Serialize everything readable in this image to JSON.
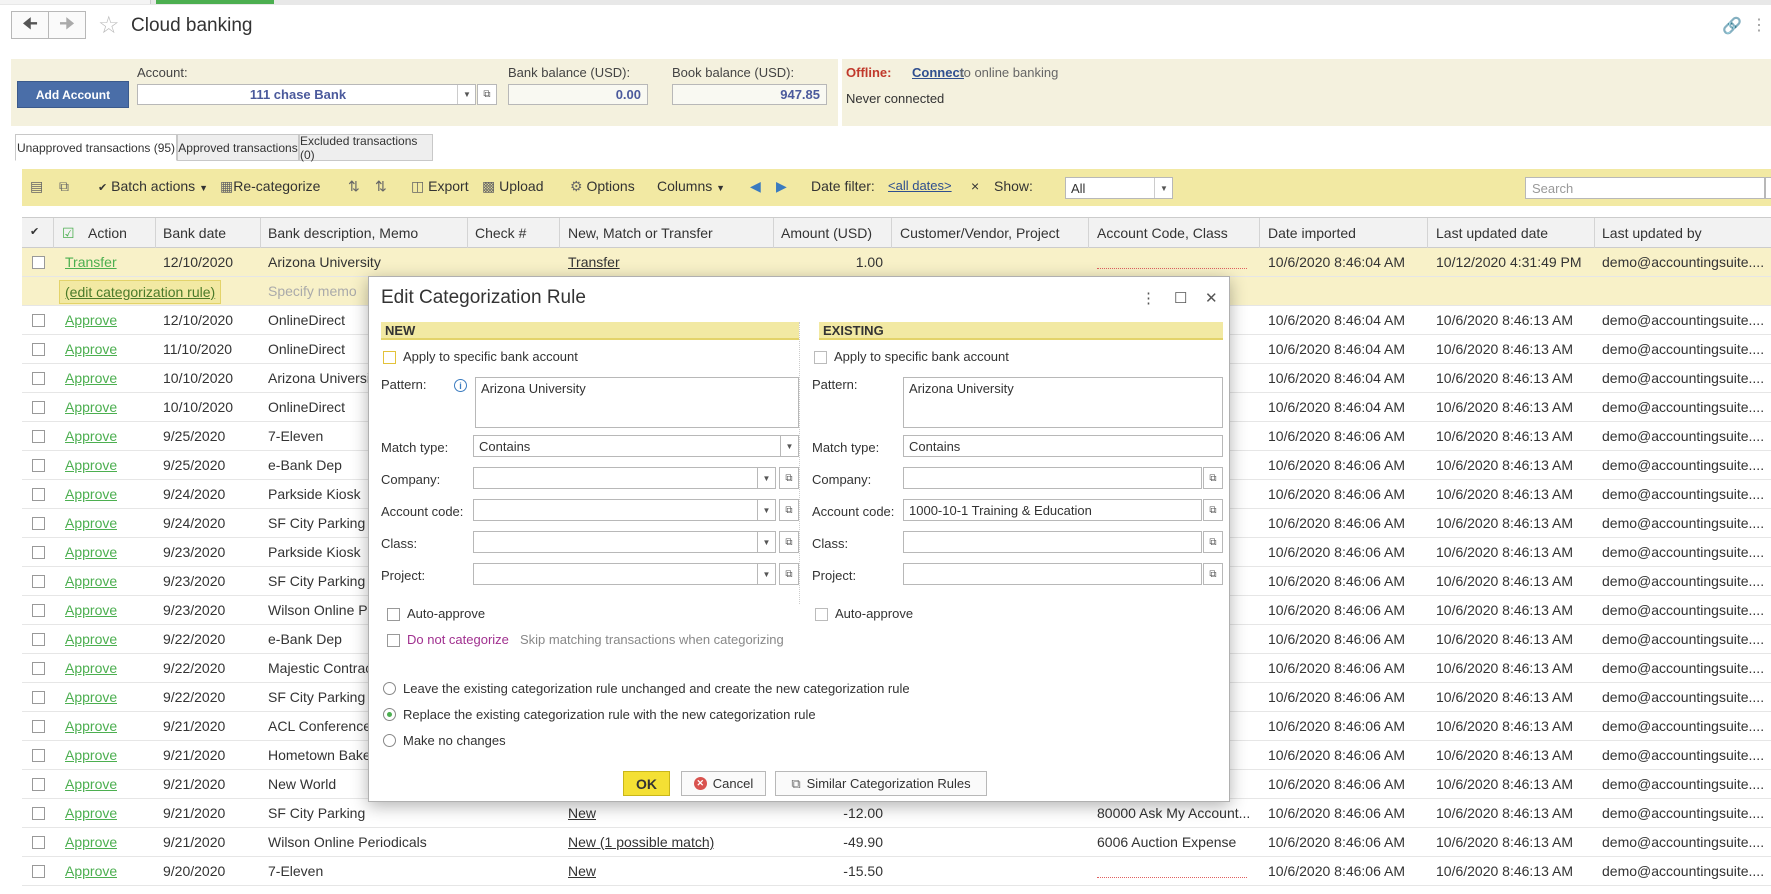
{
  "window": {
    "title": "Cloud banking"
  },
  "account_panel": {
    "add_account_label": "Add Account",
    "account_label": "Account:",
    "account_value": "111 chase Bank",
    "bank_balance_label": "Bank balance (USD):",
    "bank_balance_value": "0.00",
    "book_balance_label": "Book balance (USD):",
    "book_balance_value": "947.85"
  },
  "online_panel": {
    "status": "Offline:",
    "connect_link": "Connect",
    "connect_suffix": "to online banking",
    "connection_info": "Never connected"
  },
  "tabs": [
    {
      "label": "Unapproved transactions (95)",
      "active": true
    },
    {
      "label": "Approved transactions",
      "active": false
    },
    {
      "label": "Excluded transactions (0)",
      "active": false
    }
  ],
  "toolbar": {
    "batch_actions": "Batch actions",
    "recategorize": "Re-categorize",
    "export": "Export",
    "upload": "Upload",
    "options": "Options",
    "columns": "Columns",
    "date_filter_label": "Date filter:",
    "date_filter_value": "<all dates>",
    "clear_filter": "×",
    "show_label": "Show:",
    "show_value": "All",
    "search_placeholder": "Search",
    "search_clear": "×"
  },
  "grid": {
    "columns": [
      "Action",
      "Bank date",
      "Bank description, Memo",
      "Check #",
      "New, Match or Transfer",
      "Amount (USD)",
      "Customer/Vendor, Project",
      "Account Code, Class",
      "Date imported",
      "Last updated date",
      "Last updated by"
    ],
    "selected_row": {
      "action": "Transfer",
      "date": "12/10/2020",
      "description": "Arizona University",
      "check": "",
      "match": "Transfer",
      "amount": "1.00",
      "customer": "",
      "account": "",
      "imported": "10/6/2020 8:46:04 AM",
      "updated": "10/12/2020 4:31:49 PM",
      "by": "demo@accountingsuite...."
    },
    "sub_row": {
      "edit_rule": "(edit categorization rule)",
      "memo_placeholder": "Specify memo"
    },
    "rows": [
      {
        "action": "Approve",
        "date": "12/10/2020",
        "description": "OnlineDirect",
        "match": "",
        "amount": "",
        "account": "",
        "imported": "10/6/2020 8:46:04 AM",
        "updated": "10/6/2020 8:46:13 AM",
        "by": "demo@accountingsuite...."
      },
      {
        "action": "Approve",
        "date": "11/10/2020",
        "description": "OnlineDirect",
        "match": "",
        "amount": "",
        "account": "",
        "imported": "10/6/2020 8:46:04 AM",
        "updated": "10/6/2020 8:46:13 AM",
        "by": "demo@accountingsuite...."
      },
      {
        "action": "Approve",
        "date": "10/10/2020",
        "description": "Arizona University",
        "match": "",
        "amount": "",
        "account": "",
        "imported": "10/6/2020 8:46:04 AM",
        "updated": "10/6/2020 8:46:13 AM",
        "by": "demo@accountingsuite...."
      },
      {
        "action": "Approve",
        "date": "10/10/2020",
        "description": "OnlineDirect",
        "match": "",
        "amount": "",
        "account": "",
        "imported": "10/6/2020 8:46:04 AM",
        "updated": "10/6/2020 8:46:13 AM",
        "by": "demo@accountingsuite...."
      },
      {
        "action": "Approve",
        "date": "9/25/2020",
        "description": "7-Eleven",
        "match": "",
        "amount": "",
        "account": "",
        "imported": "10/6/2020 8:46:06 AM",
        "updated": "10/6/2020 8:46:13 AM",
        "by": "demo@accountingsuite...."
      },
      {
        "action": "Approve",
        "date": "9/25/2020",
        "description": "e-Bank Dep",
        "match": "",
        "amount": "",
        "account": "",
        "imported": "10/6/2020 8:46:06 AM",
        "updated": "10/6/2020 8:46:13 AM",
        "by": "demo@accountingsuite...."
      },
      {
        "action": "Approve",
        "date": "9/24/2020",
        "description": "Parkside Kiosk",
        "match": "",
        "amount": "",
        "account": "",
        "imported": "10/6/2020 8:46:06 AM",
        "updated": "10/6/2020 8:46:13 AM",
        "by": "demo@accountingsuite...."
      },
      {
        "action": "Approve",
        "date": "9/24/2020",
        "description": "SF City Parking",
        "match": "",
        "amount": "",
        "account": "",
        "imported": "10/6/2020 8:46:06 AM",
        "updated": "10/6/2020 8:46:13 AM",
        "by": "demo@accountingsuite...."
      },
      {
        "action": "Approve",
        "date": "9/23/2020",
        "description": "Parkside Kiosk",
        "match": "",
        "amount": "",
        "account": "",
        "imported": "10/6/2020 8:46:06 AM",
        "updated": "10/6/2020 8:46:13 AM",
        "by": "demo@accountingsuite...."
      },
      {
        "action": "Approve",
        "date": "9/23/2020",
        "description": "SF City Parking",
        "match": "",
        "amount": "",
        "account": "",
        "imported": "10/6/2020 8:46:06 AM",
        "updated": "10/6/2020 8:46:13 AM",
        "by": "demo@accountingsuite...."
      },
      {
        "action": "Approve",
        "date": "9/23/2020",
        "description": "Wilson Online Periodicals",
        "match": "",
        "amount": "",
        "account": "",
        "imported": "10/6/2020 8:46:06 AM",
        "updated": "10/6/2020 8:46:13 AM",
        "by": "demo@accountingsuite...."
      },
      {
        "action": "Approve",
        "date": "9/22/2020",
        "description": "e-Bank Dep",
        "match": "",
        "amount": "",
        "account": "",
        "imported": "10/6/2020 8:46:06 AM",
        "updated": "10/6/2020 8:46:13 AM",
        "by": "demo@accountingsuite...."
      },
      {
        "action": "Approve",
        "date": "9/22/2020",
        "description": "Majestic Contractors",
        "match": "",
        "amount": "",
        "account": "",
        "imported": "10/6/2020 8:46:06 AM",
        "updated": "10/6/2020 8:46:13 AM",
        "by": "demo@accountingsuite...."
      },
      {
        "action": "Approve",
        "date": "9/22/2020",
        "description": "SF City Parking",
        "match": "",
        "amount": "",
        "account": "",
        "imported": "10/6/2020 8:46:06 AM",
        "updated": "10/6/2020 8:46:13 AM",
        "by": "demo@accountingsuite...."
      },
      {
        "action": "Approve",
        "date": "9/21/2020",
        "description": "ACL Conferences",
        "match": "",
        "amount": "",
        "account": "",
        "imported": "10/6/2020 8:46:06 AM",
        "updated": "10/6/2020 8:46:13 AM",
        "by": "demo@accountingsuite...."
      },
      {
        "action": "Approve",
        "date": "9/21/2020",
        "description": "Hometown Bakery",
        "match": "",
        "amount": "",
        "account": "",
        "imported": "10/6/2020 8:46:06 AM",
        "updated": "10/6/2020 8:46:13 AM",
        "by": "demo@accountingsuite...."
      },
      {
        "action": "Approve",
        "date": "9/21/2020",
        "description": "New World",
        "match": "",
        "amount": "",
        "account": "",
        "imported": "10/6/2020 8:46:06 AM",
        "updated": "10/6/2020 8:46:13 AM",
        "by": "demo@accountingsuite...."
      },
      {
        "action": "Approve",
        "date": "9/21/2020",
        "description": "SF City Parking",
        "match": "New",
        "amount": "-12.00",
        "account": "80000 Ask My Account...",
        "imported": "10/6/2020 8:46:06 AM",
        "updated": "10/6/2020 8:46:13 AM",
        "by": "demo@accountingsuite...."
      },
      {
        "action": "Approve",
        "date": "9/21/2020",
        "description": "Wilson Online Periodicals",
        "match": "New (1 possible match)",
        "amount": "-49.90",
        "account": "6006 Auction Expense",
        "imported": "10/6/2020 8:46:06 AM",
        "updated": "10/6/2020 8:46:13 AM",
        "by": "demo@accountingsuite...."
      },
      {
        "action": "Approve",
        "date": "9/20/2020",
        "description": "7-Eleven",
        "match": "New",
        "amount": "-15.50",
        "account": "",
        "imported": "10/6/2020 8:46:06 AM",
        "updated": "10/6/2020 8:46:13 AM",
        "by": "demo@accountingsuite...."
      }
    ]
  },
  "dialog": {
    "title": "Edit Categorization Rule",
    "new_header": "NEW",
    "existing_header": "EXISTING",
    "apply_specific": "Apply to specific bank account",
    "pattern_label": "Pattern:",
    "match_type_label": "Match type:",
    "company_label": "Company:",
    "account_code_label": "Account code:",
    "class_label": "Class:",
    "project_label": "Project:",
    "auto_approve": "Auto-approve",
    "do_not_categorize": "Do not categorize",
    "skip_text": "Skip matching transactions when categorizing",
    "new": {
      "pattern": "Arizona University",
      "match_type": "Contains",
      "company": "",
      "account_code": "",
      "class": "",
      "project": ""
    },
    "existing": {
      "pattern": "Arizona University",
      "match_type": "Contains",
      "company": "",
      "account_code": "1000-10-1 Training & Education",
      "class": "",
      "project": ""
    },
    "options": [
      {
        "label": "Leave the existing categorization rule unchanged and create the new categorization rule",
        "selected": false
      },
      {
        "label": "Replace the existing categorization rule with the new categorization rule",
        "selected": true
      },
      {
        "label": "Make no changes",
        "selected": false
      }
    ],
    "ok_label": "OK",
    "cancel_label": "Cancel",
    "similar_label": "Similar Categorization Rules"
  }
}
